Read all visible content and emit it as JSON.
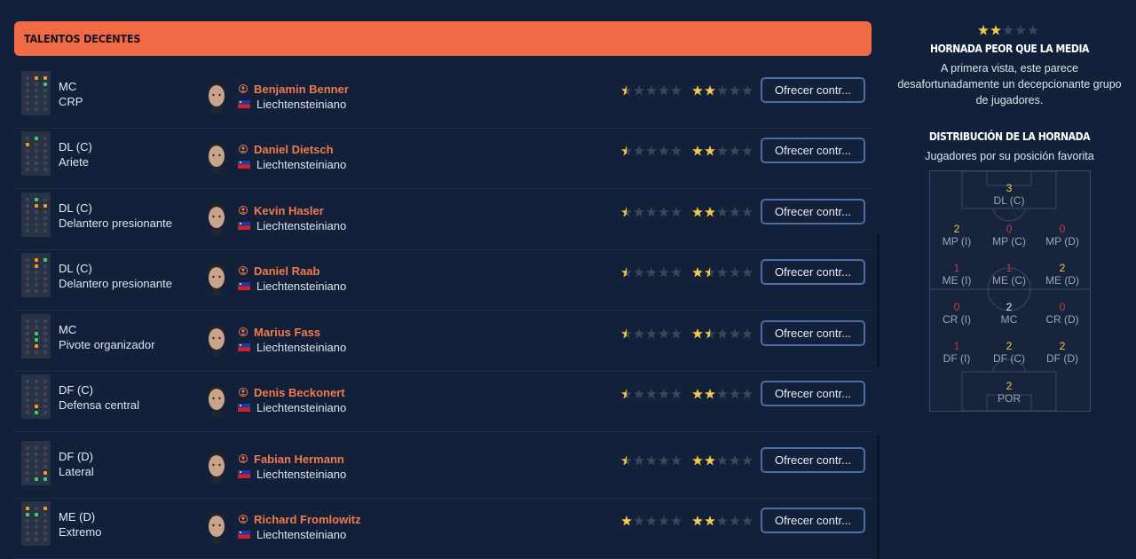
{
  "section": {
    "title": "TALENTOS DECENTES"
  },
  "players": [
    {
      "position": "MC",
      "role": "CRP",
      "name": "Benjamin Benner",
      "nationality": "Liechtensteiniano",
      "current_ability_stars": 0.5,
      "potential_ability_stars": 2,
      "action_label": "Ofrecer contr..."
    },
    {
      "position": "DL (C)",
      "role": "Ariete",
      "name": "Daniel Dietsch",
      "nationality": "Liechtensteiniano",
      "current_ability_stars": 0.5,
      "potential_ability_stars": 2,
      "action_label": "Ofrecer contr..."
    },
    {
      "position": "DL (C)",
      "role": "Delantero presionante",
      "name": "Kevin Hasler",
      "nationality": "Liechtensteiniano",
      "current_ability_stars": 0.5,
      "potential_ability_stars": 2,
      "action_label": "Ofrecer contr..."
    },
    {
      "position": "DL (C)",
      "role": "Delantero presionante",
      "name": "Daniel Raab",
      "nationality": "Liechtensteiniano",
      "current_ability_stars": 0.5,
      "potential_ability_stars": 1.5,
      "action_label": "Ofrecer contr..."
    },
    {
      "position": "MC",
      "role": "Pivote organizador",
      "name": "Marius Fass",
      "nationality": "Liechtensteiniano",
      "current_ability_stars": 0.5,
      "potential_ability_stars": 1.5,
      "action_label": "Ofrecer contr..."
    },
    {
      "position": "DF (C)",
      "role": "Defensa central",
      "name": "Denis Beckonert",
      "nationality": "Liechtensteiniano",
      "current_ability_stars": 0.5,
      "potential_ability_stars": 2,
      "action_label": "Ofrecer contr..."
    },
    {
      "position": "DF (D)",
      "role": "Lateral",
      "name": "Fabian Hermann",
      "nationality": "Liechtensteiniano",
      "current_ability_stars": 0.5,
      "potential_ability_stars": 2,
      "action_label": "Ofrecer contr..."
    },
    {
      "position": "ME (D)",
      "role": "Extremo",
      "name": "Richard Fromlowitz",
      "nationality": "Liechtensteiniano",
      "current_ability_stars": 1,
      "potential_ability_stars": 2,
      "action_label": "Ofrecer contr..."
    }
  ],
  "summary": {
    "rating_stars": 2,
    "title": "HORNADA PEOR QUE LA MEDIA",
    "text": "A primera vista, este parece desafortunadamente un decepcionante grupo de jugadores.",
    "distribution_title": "DISTRIBUCIÓN DE LA HORNADA",
    "distribution_subtitle": "Jugadores por su posición favorita",
    "zones": [
      {
        "label": "DL (C)",
        "count": "3"
      },
      {
        "label": "MP (I)",
        "count": "2"
      },
      {
        "label": "MP (C)",
        "count": "0"
      },
      {
        "label": "MP (D)",
        "count": "0"
      },
      {
        "label": "ME (I)",
        "count": "1"
      },
      {
        "label": "ME (C)",
        "count": "1"
      },
      {
        "label": "ME (D)",
        "count": "2"
      },
      {
        "label": "CR (I)",
        "count": "0"
      },
      {
        "label": "MC",
        "count": "2"
      },
      {
        "label": "CR (D)",
        "count": "0"
      },
      {
        "label": "DF (I)",
        "count": "1"
      },
      {
        "label": "DF (C)",
        "count": "2"
      },
      {
        "label": "DF (D)",
        "count": "2"
      },
      {
        "label": "POR",
        "count": "2"
      }
    ]
  },
  "colors": {
    "accent": "#ef6a45",
    "name": "#f07a4a",
    "star": "#f2c94c",
    "zero": "#c43b3b"
  }
}
